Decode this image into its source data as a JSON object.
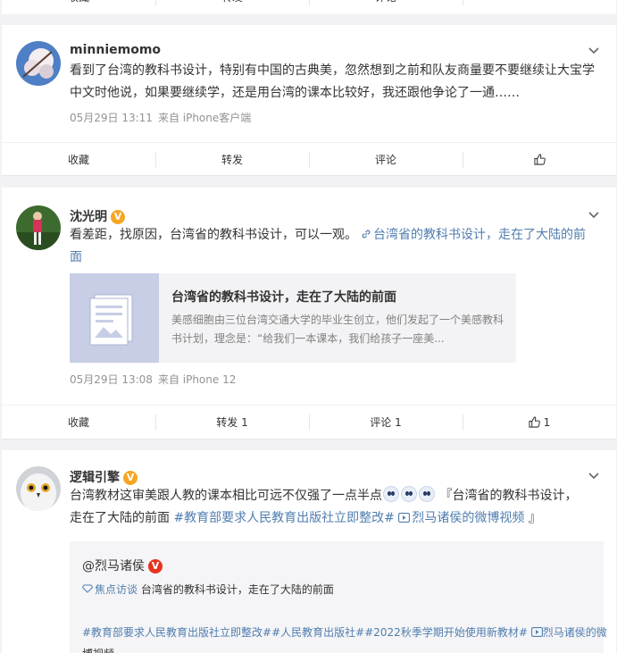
{
  "top_toolbar": {
    "items": [
      "收藏",
      "转发",
      "评论"
    ]
  },
  "posts": [
    {
      "username": "minniemomo",
      "text": "看到了台湾的教科书设计，特别有中国的古典美，忽然想到之前和队友商量要不要继续让大宝学中文时他说，如果要继续学，还是用台湾的课本比较好，我还跟他争论了一通……",
      "time": "05月29日 13:11",
      "source": "来自 iPhone客户端",
      "toolbar": {
        "collect": "收藏",
        "repost": "转发",
        "comment": "评论",
        "like": ""
      }
    },
    {
      "username": "沈光明",
      "badge": "V",
      "text": "看差距，找原因，台湾省的教科书设计，可以一观。",
      "link_text": "台湾省的教科书设计，走在了大陆的前面",
      "card": {
        "title": "台湾省的教科书设计，走在了大陆的前面",
        "desc": "美感细胞由三位台湾交通大学的毕业生创立，他们发起了一个美感教科书计划，理念是：“给我们一本课本，我们给孩子一座美..."
      },
      "time": "05月29日 13:08",
      "source": "来自 iPhone 12",
      "toolbar": {
        "collect": "收藏",
        "repost": "转发 1",
        "comment": "评论 1",
        "like": "1"
      }
    },
    {
      "username": "逻辑引擎",
      "badge": "V",
      "text_a": "台湾教材这审美跟人教的课本相比可远不仅强了一点半点",
      "text_b": "『台湾省的教科书设计，",
      "text_c": "走在了大陆的前面",
      "tag1": "#教育部要求人民教育出版社立即整改#",
      "video_link": "烈马诸侯的微博视频",
      "text_end": "』",
      "repost": {
        "user": "@烈马诸侯",
        "badge": "V",
        "topic": "焦点访谈",
        "line1": "台湾省的教科书设计，走在了大陆的前面",
        "tags": "#教育部要求人民教育出版社立即整改##人民教育出版社##2022秋季学期开始使用新教材#",
        "video": "烈马诸侯的微",
        "video_tail": "博视频"
      }
    }
  ]
}
